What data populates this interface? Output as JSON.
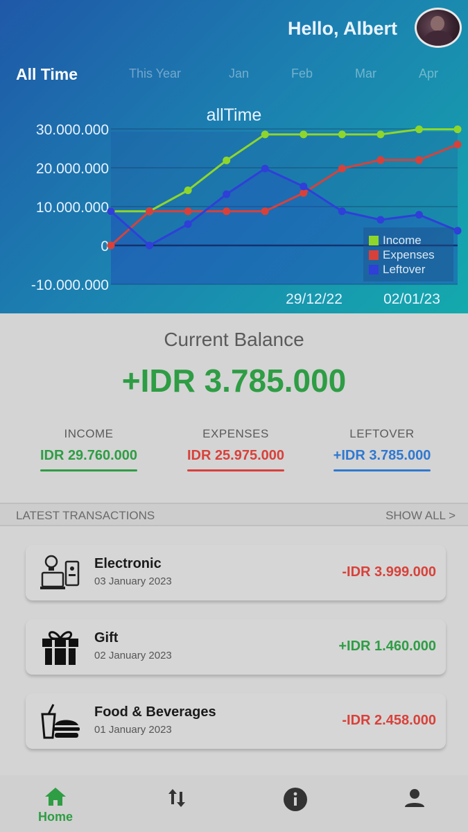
{
  "header": {
    "greeting": "Hello, Albert",
    "tabs": [
      "All Time",
      "This Year",
      "Jan",
      "Feb",
      "Mar",
      "Apr"
    ],
    "active_tab": "All Time"
  },
  "chart_data": {
    "type": "line",
    "title": "allTime",
    "ylim": [
      -10000000,
      30000000
    ],
    "y_ticks": [
      "30.000.000",
      "20.000.000",
      "10.000.000",
      "0",
      "-10.000.000"
    ],
    "x_tick_labels": [
      "29/12/22",
      "02/01/23"
    ],
    "legend_position": "bottom-right",
    "series": [
      {
        "name": "Income",
        "color": "#8fd62b",
        "values": [
          8800000,
          8800000,
          14200000,
          21900000,
          28600000,
          28600000,
          28600000,
          28600000,
          29900000,
          29900000
        ]
      },
      {
        "name": "Expenses",
        "color": "#d8413a",
        "values": [
          0,
          8800000,
          8800000,
          8800000,
          8800000,
          13500000,
          19800000,
          22000000,
          22000000,
          26000000
        ]
      },
      {
        "name": "Leftover",
        "color": "#2f3fd8",
        "values": [
          8800000,
          0,
          5500000,
          13200000,
          19800000,
          15200000,
          8800000,
          6600000,
          7900000,
          3800000
        ]
      }
    ]
  },
  "balance": {
    "label": "Current Balance",
    "value": "+IDR 3.785.000"
  },
  "summary": {
    "income_label": "INCOME",
    "income_value": "IDR 29.760.000",
    "expenses_label": "EXPENSES",
    "expenses_value": "IDR 25.975.000",
    "leftover_label": "LEFTOVER",
    "leftover_value": "+IDR 3.785.000"
  },
  "transactions": {
    "section_title": "LATEST TRANSACTIONS",
    "show_all": "SHOW ALL >",
    "items": [
      {
        "name": "Electronic",
        "date": "03 January 2023",
        "amount": "-IDR 3.999.000",
        "icon": "electronic-icon"
      },
      {
        "name": "Gift",
        "date": "02 January 2023",
        "amount": "+IDR 1.460.000",
        "icon": "gift-icon"
      },
      {
        "name": "Food & Beverages",
        "date": "01 January 2023",
        "amount": "-IDR 2.458.000",
        "icon": "food-icon"
      }
    ]
  },
  "nav": {
    "home_label": "Home"
  },
  "colors": {
    "income": "#2e9d44",
    "expense": "#d8413a",
    "leftover": "#2f78d0"
  }
}
